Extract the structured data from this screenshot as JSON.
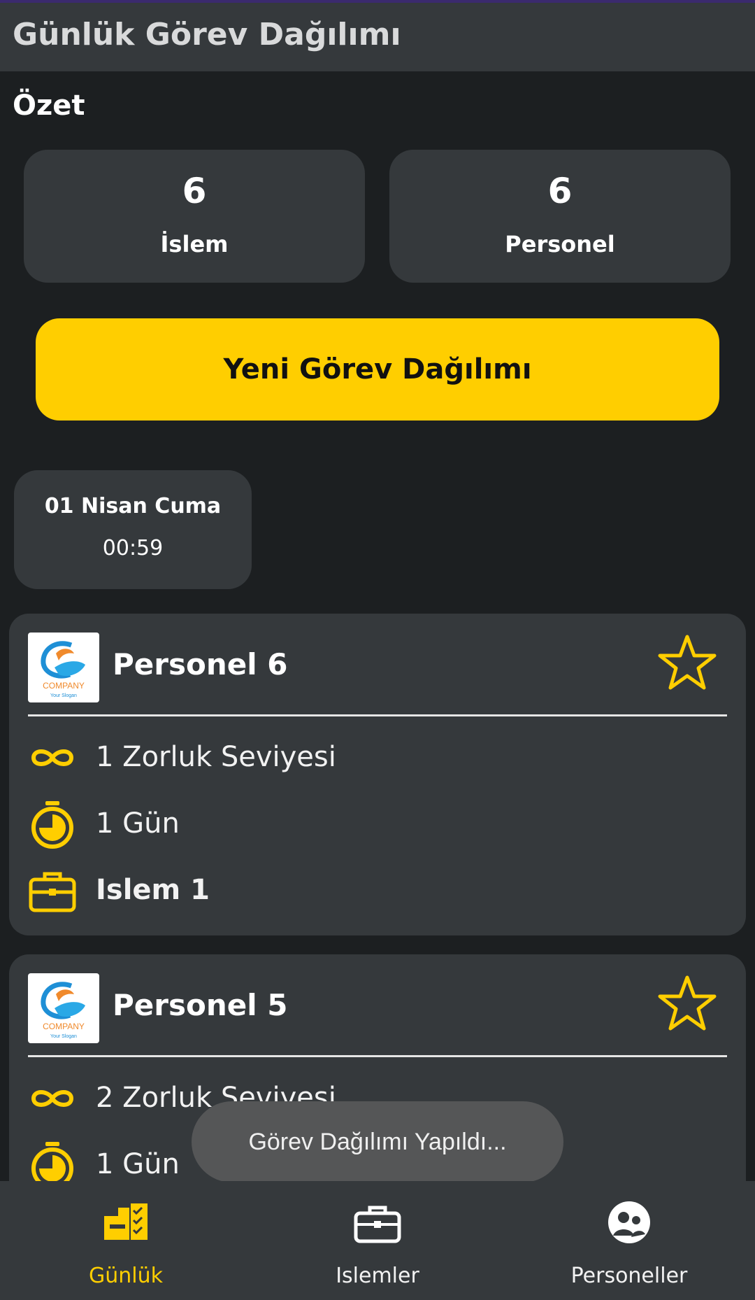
{
  "app": {
    "title": "Günlük Görev Dağılımı"
  },
  "summary": {
    "heading": "Özet",
    "cards": [
      {
        "value": "6",
        "label": "İslem"
      },
      {
        "value": "6",
        "label": "Personel"
      }
    ]
  },
  "actions": {
    "new_assignment_label": "Yeni Görev Dağılımı"
  },
  "date_card": {
    "date": "01 Nisan Cuma",
    "time": "00:59"
  },
  "assignments": [
    {
      "person": "Personel 6",
      "difficulty": "1 Zorluk Seviyesi",
      "duration": "1 Gün",
      "task": "Islem 1",
      "logo": {
        "brand": "COMPANY",
        "slogan": "Your Slogan"
      }
    },
    {
      "person": "Personel 5",
      "difficulty": "2 Zorluk Seviyesi",
      "duration": "1 Gün",
      "task": "",
      "logo": {
        "brand": "COMPANY",
        "slogan": "Your Slogan"
      }
    }
  ],
  "toast": {
    "message": "Görev Dağılımı Yapıldı..."
  },
  "bottom_nav": {
    "items": [
      {
        "label": "Günlük",
        "icon": "daily-tasks-icon",
        "active": true
      },
      {
        "label": "Islemler",
        "icon": "briefcase-icon",
        "active": false
      },
      {
        "label": "Personeller",
        "icon": "people-icon",
        "active": false
      }
    ]
  },
  "colors": {
    "accent": "#ffce00",
    "background": "#1c1f21",
    "card": "#35393c",
    "toast": "#555657"
  }
}
